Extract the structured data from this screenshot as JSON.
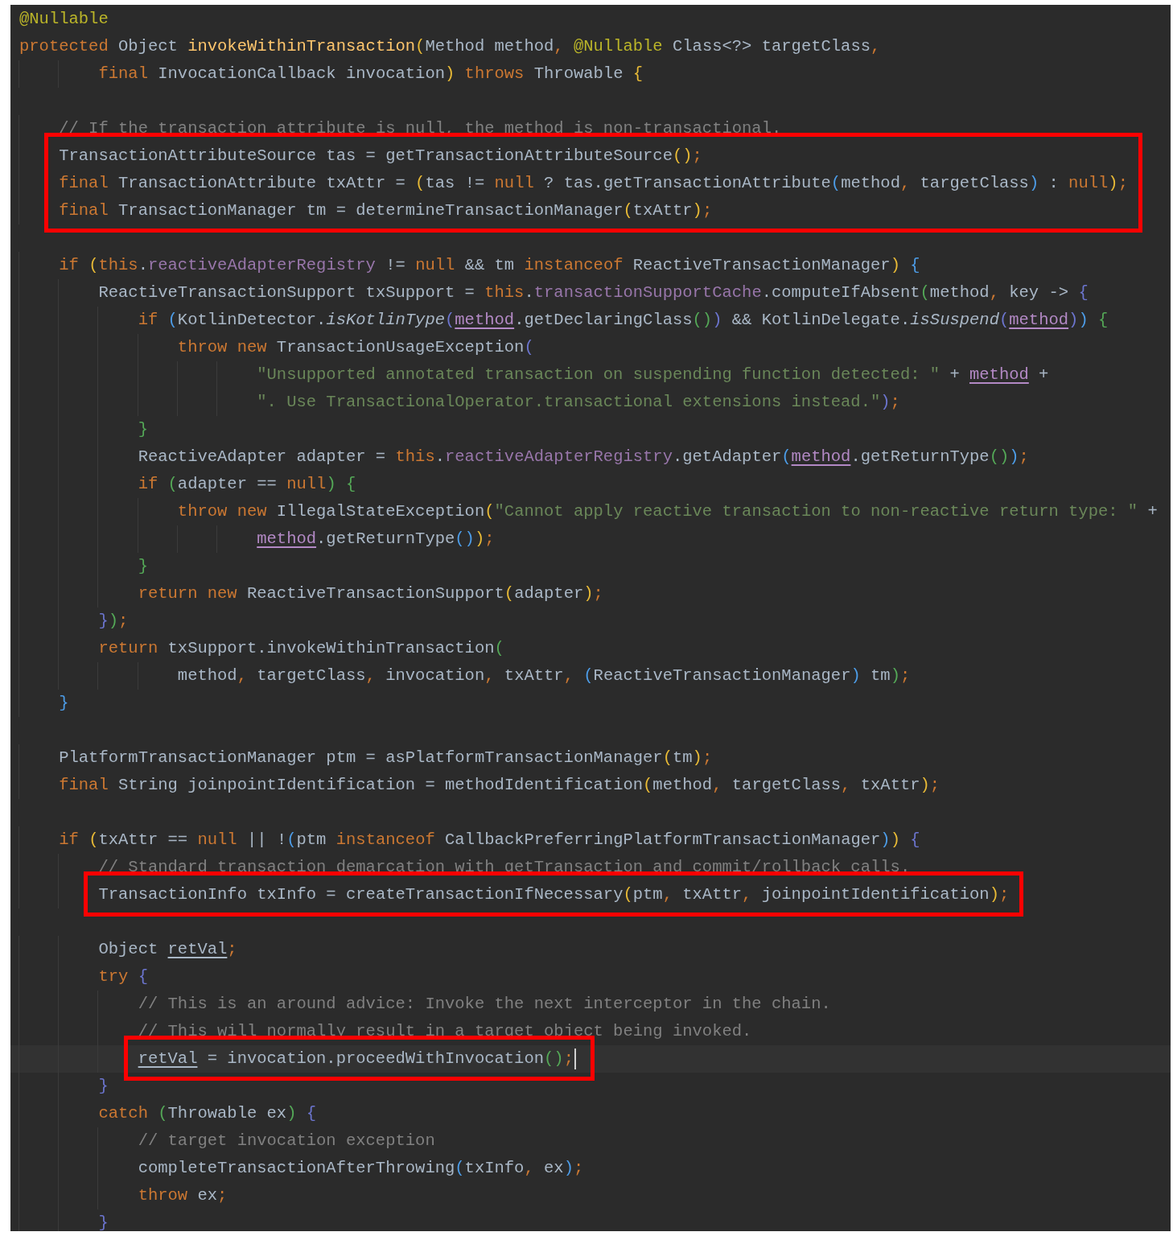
{
  "lines": [
    {
      "kind": "line",
      "current": false,
      "tokens": [
        {
          "text": "@Nullable",
          "kind": "annotation"
        }
      ]
    },
    {
      "kind": "line",
      "current": false,
      "tokens": [
        {
          "text": "protected",
          "kind": "keyword"
        },
        {
          "text": " Object ",
          "kind": "plain"
        },
        {
          "text": "invokeWithinTransaction",
          "kind": "declaration"
        },
        {
          "text": "(",
          "kind": "gold"
        },
        {
          "text": "Method method",
          "kind": "plain"
        },
        {
          "text": ", ",
          "kind": "punct"
        },
        {
          "text": "@Nullable",
          "kind": "annotation"
        },
        {
          "text": " Class<?> targetClass",
          "kind": "plain"
        },
        {
          "text": ",",
          "kind": "punct"
        }
      ]
    },
    {
      "kind": "line",
      "current": false,
      "tokens": [
        {
          "text": "        final",
          "kind": "keyword"
        },
        {
          "text": " InvocationCallback invocation",
          "kind": "plain"
        },
        {
          "text": ") ",
          "kind": "gold"
        },
        {
          "text": "throws",
          "kind": "keyword"
        },
        {
          "text": " Throwable ",
          "kind": "plain"
        },
        {
          "text": "{",
          "kind": "gold"
        }
      ]
    },
    {
      "kind": "blank"
    },
    {
      "kind": "line",
      "current": false,
      "tokens": [
        {
          "text": "    // If the transaction attribute is null, the method is non-transactional.",
          "kind": "comment"
        }
      ]
    },
    {
      "kind": "boxed",
      "lines": [
        {
          "kind": "line",
          "current": false,
          "tokens": [
            {
              "text": "    TransactionAttributeSource tas = getTransactionAttributeSource",
              "kind": "plain"
            },
            {
              "text": "()",
              "kind": "gold"
            },
            {
              "text": ";",
              "kind": "punct"
            }
          ]
        },
        {
          "kind": "line",
          "current": false,
          "tokens": [
            {
              "text": "    final",
              "kind": "keyword"
            },
            {
              "text": " TransactionAttribute txAttr = ",
              "kind": "plain"
            },
            {
              "text": "(",
              "kind": "gold"
            },
            {
              "text": "tas != ",
              "kind": "plain"
            },
            {
              "text": "null",
              "kind": "keyword"
            },
            {
              "text": " ? tas.getTransactionAttribute",
              "kind": "plain"
            },
            {
              "text": "(",
              "kind": "blue"
            },
            {
              "text": "method",
              "kind": "plain"
            },
            {
              "text": ",",
              "kind": "punct"
            },
            {
              "text": " targetClass",
              "kind": "plain"
            },
            {
              "text": ")",
              "kind": "blue"
            },
            {
              "text": " : ",
              "kind": "plain"
            },
            {
              "text": "null",
              "kind": "keyword"
            },
            {
              "text": ")",
              "kind": "gold"
            },
            {
              "text": ";",
              "kind": "punct"
            }
          ]
        },
        {
          "kind": "line",
          "current": false,
          "tokens": [
            {
              "text": "    final",
              "kind": "keyword"
            },
            {
              "text": " TransactionManager tm = determineTransactionManager",
              "kind": "plain"
            },
            {
              "text": "(",
              "kind": "gold"
            },
            {
              "text": "txAttr",
              "kind": "plain"
            },
            {
              "text": ")",
              "kind": "gold"
            },
            {
              "text": ";",
              "kind": "punct"
            }
          ]
        }
      ]
    },
    {
      "kind": "blank"
    },
    {
      "kind": "line",
      "current": false,
      "tokens": [
        {
          "text": "    if ",
          "kind": "keyword"
        },
        {
          "text": "(",
          "kind": "gold"
        },
        {
          "text": "this",
          "kind": "keyword"
        },
        {
          "text": ".",
          "kind": "plain"
        },
        {
          "text": "reactiveAdapterRegistry",
          "kind": "field"
        },
        {
          "text": " != ",
          "kind": "plain"
        },
        {
          "text": "null",
          "kind": "keyword"
        },
        {
          "text": " && tm ",
          "kind": "plain"
        },
        {
          "text": "instanceof",
          "kind": "keyword"
        },
        {
          "text": " ReactiveTransactionManager",
          "kind": "plain"
        },
        {
          "text": ") ",
          "kind": "gold"
        },
        {
          "text": "{",
          "kind": "blue"
        }
      ]
    },
    {
      "kind": "line",
      "current": false,
      "tokens": [
        {
          "text": "        ReactiveTransactionSupport txSupport = ",
          "kind": "plain"
        },
        {
          "text": "this",
          "kind": "keyword"
        },
        {
          "text": ".",
          "kind": "plain"
        },
        {
          "text": "transactionSupportCache",
          "kind": "field"
        },
        {
          "text": ".computeIfAbsent",
          "kind": "plain"
        },
        {
          "text": "(",
          "kind": "green"
        },
        {
          "text": "method",
          "kind": "plain"
        },
        {
          "text": ",",
          "kind": "punct"
        },
        {
          "text": " key -> ",
          "kind": "plain"
        },
        {
          "text": "{",
          "kind": "indigo"
        }
      ]
    },
    {
      "kind": "line",
      "current": false,
      "tokens": [
        {
          "text": "            if ",
          "kind": "keyword"
        },
        {
          "text": "(",
          "kind": "blue"
        },
        {
          "text": "KotlinDetector.",
          "kind": "plain"
        },
        {
          "text": "isKotlinType",
          "kind": "static"
        },
        {
          "text": "(",
          "kind": "indigo"
        },
        {
          "text": "method",
          "kind": "captured"
        },
        {
          "text": ".getDeclaringClass",
          "kind": "plain"
        },
        {
          "text": "()",
          "kind": "green"
        },
        {
          "text": ")",
          "kind": "indigo"
        },
        {
          "text": " && KotlinDelegate.",
          "kind": "plain"
        },
        {
          "text": "isSuspend",
          "kind": "static"
        },
        {
          "text": "(",
          "kind": "indigo"
        },
        {
          "text": "method",
          "kind": "captured"
        },
        {
          "text": ")",
          "kind": "indigo"
        },
        {
          "text": ") ",
          "kind": "blue"
        },
        {
          "text": "{",
          "kind": "green"
        }
      ]
    },
    {
      "kind": "line",
      "current": false,
      "tokens": [
        {
          "text": "                throw new",
          "kind": "keyword"
        },
        {
          "text": " TransactionUsageException",
          "kind": "plain"
        },
        {
          "text": "(",
          "kind": "indigo"
        }
      ]
    },
    {
      "kind": "line",
      "current": false,
      "tokens": [
        {
          "text": "                        \"Unsupported annotated transaction on suspending function detected: \"",
          "kind": "string"
        },
        {
          "text": " + ",
          "kind": "plain"
        },
        {
          "text": "method",
          "kind": "captured"
        },
        {
          "text": " +",
          "kind": "plain"
        }
      ]
    },
    {
      "kind": "line",
      "current": false,
      "tokens": [
        {
          "text": "                        \". Use TransactionalOperator.transactional extensions instead.\"",
          "kind": "string"
        },
        {
          "text": ")",
          "kind": "indigo"
        },
        {
          "text": ";",
          "kind": "punct"
        }
      ]
    },
    {
      "kind": "line",
      "current": false,
      "tokens": [
        {
          "text": "            }",
          "kind": "green"
        }
      ]
    },
    {
      "kind": "line",
      "current": false,
      "tokens": [
        {
          "text": "            ReactiveAdapter adapter = ",
          "kind": "plain"
        },
        {
          "text": "this",
          "kind": "keyword"
        },
        {
          "text": ".",
          "kind": "plain"
        },
        {
          "text": "reactiveAdapterRegistry",
          "kind": "field"
        },
        {
          "text": ".getAdapter",
          "kind": "plain"
        },
        {
          "text": "(",
          "kind": "blue"
        },
        {
          "text": "method",
          "kind": "captured"
        },
        {
          "text": ".getReturnType",
          "kind": "plain"
        },
        {
          "text": "()",
          "kind": "green"
        },
        {
          "text": ")",
          "kind": "blue"
        },
        {
          "text": ";",
          "kind": "punct"
        }
      ]
    },
    {
      "kind": "line",
      "current": false,
      "tokens": [
        {
          "text": "            if ",
          "kind": "keyword"
        },
        {
          "text": "(",
          "kind": "green"
        },
        {
          "text": "adapter == ",
          "kind": "plain"
        },
        {
          "text": "null",
          "kind": "keyword"
        },
        {
          "text": ") {",
          "kind": "green"
        }
      ]
    },
    {
      "kind": "line",
      "current": false,
      "tokens": [
        {
          "text": "                throw new",
          "kind": "keyword"
        },
        {
          "text": " IllegalStateException",
          "kind": "plain"
        },
        {
          "text": "(",
          "kind": "gold"
        },
        {
          "text": "\"Cannot apply reactive transaction to non-reactive return type: \"",
          "kind": "string"
        },
        {
          "text": " +",
          "kind": "plain"
        }
      ]
    },
    {
      "kind": "line",
      "current": false,
      "tokens": [
        {
          "text": "                        method",
          "kind": "captured"
        },
        {
          "text": ".getReturnType",
          "kind": "plain"
        },
        {
          "text": "()",
          "kind": "blue"
        },
        {
          "text": ")",
          "kind": "gold"
        },
        {
          "text": ";",
          "kind": "punct"
        }
      ]
    },
    {
      "kind": "line",
      "current": false,
      "tokens": [
        {
          "text": "            }",
          "kind": "green"
        }
      ]
    },
    {
      "kind": "line",
      "current": false,
      "tokens": [
        {
          "text": "            return new",
          "kind": "keyword"
        },
        {
          "text": " ReactiveTransactionSupport",
          "kind": "plain"
        },
        {
          "text": "(",
          "kind": "gold"
        },
        {
          "text": "adapter",
          "kind": "plain"
        },
        {
          "text": ")",
          "kind": "gold"
        },
        {
          "text": ";",
          "kind": "punct"
        }
      ]
    },
    {
      "kind": "line",
      "current": false,
      "tokens": [
        {
          "text": "        }",
          "kind": "indigo"
        },
        {
          "text": ")",
          "kind": "green"
        },
        {
          "text": ";",
          "kind": "punct"
        }
      ]
    },
    {
      "kind": "line",
      "current": false,
      "tokens": [
        {
          "text": "        return",
          "kind": "keyword"
        },
        {
          "text": " txSupport.invokeWithinTransaction",
          "kind": "plain"
        },
        {
          "text": "(",
          "kind": "green"
        }
      ]
    },
    {
      "kind": "line",
      "current": false,
      "tokens": [
        {
          "text": "                method",
          "kind": "plain"
        },
        {
          "text": ",",
          "kind": "punct"
        },
        {
          "text": " targetClass",
          "kind": "plain"
        },
        {
          "text": ",",
          "kind": "punct"
        },
        {
          "text": " invocation",
          "kind": "plain"
        },
        {
          "text": ",",
          "kind": "punct"
        },
        {
          "text": " txAttr",
          "kind": "plain"
        },
        {
          "text": ", ",
          "kind": "punct"
        },
        {
          "text": "(",
          "kind": "blue"
        },
        {
          "text": "ReactiveTransactionManager",
          "kind": "plain"
        },
        {
          "text": ")",
          "kind": "blue"
        },
        {
          "text": " tm",
          "kind": "plain"
        },
        {
          "text": ")",
          "kind": "green"
        },
        {
          "text": ";",
          "kind": "punct"
        }
      ]
    },
    {
      "kind": "line",
      "current": false,
      "tokens": [
        {
          "text": "    }",
          "kind": "blue"
        }
      ]
    },
    {
      "kind": "blank"
    },
    {
      "kind": "line",
      "current": false,
      "tokens": [
        {
          "text": "    PlatformTransactionManager ptm = asPlatformTransactionManager",
          "kind": "plain"
        },
        {
          "text": "(",
          "kind": "gold"
        },
        {
          "text": "tm",
          "kind": "plain"
        },
        {
          "text": ")",
          "kind": "gold"
        },
        {
          "text": ";",
          "kind": "punct"
        }
      ]
    },
    {
      "kind": "line",
      "current": false,
      "tokens": [
        {
          "text": "    final",
          "kind": "keyword"
        },
        {
          "text": " String joinpointIdentification = methodIdentification",
          "kind": "plain"
        },
        {
          "text": "(",
          "kind": "gold"
        },
        {
          "text": "method",
          "kind": "plain"
        },
        {
          "text": ",",
          "kind": "punct"
        },
        {
          "text": " targetClass",
          "kind": "plain"
        },
        {
          "text": ",",
          "kind": "punct"
        },
        {
          "text": " txAttr",
          "kind": "plain"
        },
        {
          "text": ")",
          "kind": "gold"
        },
        {
          "text": ";",
          "kind": "punct"
        }
      ]
    },
    {
      "kind": "blank"
    },
    {
      "kind": "line",
      "current": false,
      "tokens": [
        {
          "text": "    if ",
          "kind": "keyword"
        },
        {
          "text": "(",
          "kind": "gold"
        },
        {
          "text": "txAttr == ",
          "kind": "plain"
        },
        {
          "text": "null",
          "kind": "keyword"
        },
        {
          "text": " || !",
          "kind": "plain"
        },
        {
          "text": "(",
          "kind": "blue"
        },
        {
          "text": "ptm ",
          "kind": "plain"
        },
        {
          "text": "instanceof",
          "kind": "keyword"
        },
        {
          "text": " CallbackPreferringPlatformTransactionManager",
          "kind": "plain"
        },
        {
          "text": ")",
          "kind": "blue"
        },
        {
          "text": ") ",
          "kind": "gold"
        },
        {
          "text": "{",
          "kind": "indigo"
        }
      ]
    },
    {
      "kind": "line",
      "current": false,
      "tokens": [
        {
          "text": "        // Standard transaction demarcation with getTransaction and commit/rollback calls.",
          "kind": "comment"
        }
      ]
    },
    {
      "kind": "boxed",
      "lines": [
        {
          "kind": "line",
          "current": false,
          "tokens": [
            {
              "text": "        TransactionInfo txInfo = createTransactionIfNecessary",
              "kind": "plain"
            },
            {
              "text": "(",
              "kind": "gold"
            },
            {
              "text": "ptm",
              "kind": "plain"
            },
            {
              "text": ",",
              "kind": "punct"
            },
            {
              "text": " txAttr",
              "kind": "plain"
            },
            {
              "text": ",",
              "kind": "punct"
            },
            {
              "text": " joinpointIdentification",
              "kind": "plain"
            },
            {
              "text": ")",
              "kind": "gold"
            },
            {
              "text": ";",
              "kind": "punct"
            }
          ]
        }
      ]
    },
    {
      "kind": "blank"
    },
    {
      "kind": "line",
      "current": false,
      "tokens": [
        {
          "text": "        Object ",
          "kind": "plain"
        },
        {
          "text": "retVal",
          "kind": "reassigned"
        },
        {
          "text": ";",
          "kind": "punct"
        }
      ]
    },
    {
      "kind": "line",
      "current": false,
      "tokens": [
        {
          "text": "        try ",
          "kind": "keyword"
        },
        {
          "text": "{",
          "kind": "indigo"
        }
      ]
    },
    {
      "kind": "line",
      "current": false,
      "tokens": [
        {
          "text": "            // This is an around advice: Invoke the next interceptor in the chain.",
          "kind": "comment"
        }
      ]
    },
    {
      "kind": "line",
      "current": false,
      "tokens": [
        {
          "text": "            // This will normally result in a target object being invoked.",
          "kind": "comment"
        }
      ]
    },
    {
      "kind": "boxed",
      "lines": [
        {
          "kind": "line",
          "current": true,
          "tokens": [
            {
              "text": "            retVal",
              "kind": "reassigned"
            },
            {
              "text": " = invocation.proceedWithInvocation",
              "kind": "plain"
            },
            {
              "text": "()",
              "kind": "green"
            },
            {
              "text": ";",
              "kind": "punct"
            }
          ]
        }
      ]
    },
    {
      "kind": "line",
      "current": false,
      "tokens": [
        {
          "text": "        }",
          "kind": "indigo"
        }
      ]
    },
    {
      "kind": "line",
      "current": false,
      "tokens": [
        {
          "text": "        catch ",
          "kind": "keyword"
        },
        {
          "text": "(",
          "kind": "green"
        },
        {
          "text": "Throwable ex",
          "kind": "plain"
        },
        {
          "text": ") ",
          "kind": "green"
        },
        {
          "text": "{",
          "kind": "indigo"
        }
      ]
    },
    {
      "kind": "line",
      "current": false,
      "tokens": [
        {
          "text": "            // target invocation exception",
          "kind": "comment"
        }
      ]
    },
    {
      "kind": "line",
      "current": false,
      "tokens": [
        {
          "text": "            completeTransactionAfterThrowing",
          "kind": "plain"
        },
        {
          "text": "(",
          "kind": "blue"
        },
        {
          "text": "txInfo",
          "kind": "plain"
        },
        {
          "text": ",",
          "kind": "punct"
        },
        {
          "text": " ex",
          "kind": "plain"
        },
        {
          "text": ")",
          "kind": "blue"
        },
        {
          "text": ";",
          "kind": "punct"
        }
      ]
    },
    {
      "kind": "line",
      "current": false,
      "tokens": [
        {
          "text": "            throw",
          "kind": "keyword"
        },
        {
          "text": " ex",
          "kind": "plain"
        },
        {
          "text": ";",
          "kind": "punct"
        }
      ]
    },
    {
      "kind": "line",
      "current": false,
      "tokens": [
        {
          "text": "        }",
          "kind": "indigo"
        }
      ]
    }
  ]
}
